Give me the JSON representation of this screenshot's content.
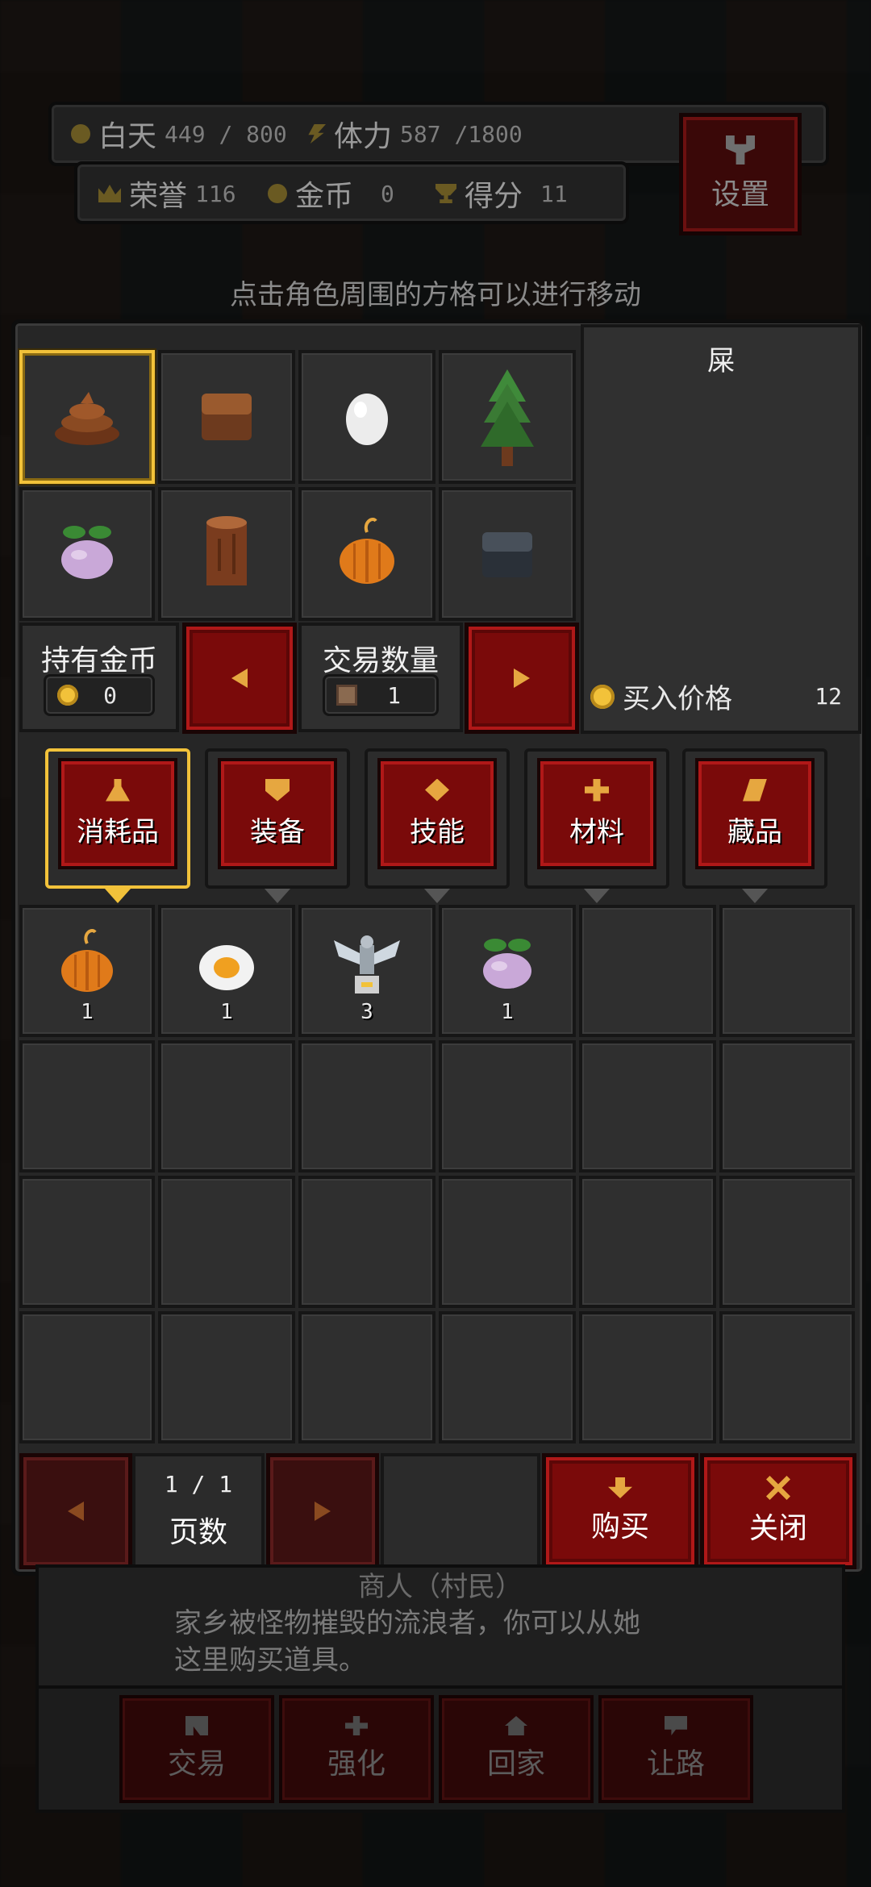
{
  "hud": {
    "day_label": "白天",
    "day_value": "449 / 800",
    "stamina_label": "体力",
    "stamina_value": "587 /1800",
    "honor_label": "荣誉",
    "honor_value": "116",
    "gold_label": "金币",
    "gold_value": "0",
    "score_label": "得分",
    "score_value": "11",
    "settings_label": "设置"
  },
  "hint": "点击角色周围的方格可以进行移动",
  "shop_items": [
    {
      "icon": "poop-icon",
      "selected": true
    },
    {
      "icon": "brick-block-icon"
    },
    {
      "icon": "egg-icon"
    },
    {
      "icon": "pine-tree-icon"
    },
    {
      "icon": "turnip-icon"
    },
    {
      "icon": "log-icon"
    },
    {
      "icon": "pumpkin-icon"
    },
    {
      "icon": "stone-block-icon"
    }
  ],
  "detail": {
    "name": "屎",
    "price_label": "买入价格",
    "price_value": "12"
  },
  "gold_box": {
    "label": "持有金币",
    "value": "0"
  },
  "qty_box": {
    "label": "交易数量",
    "value": "1"
  },
  "tabs": [
    {
      "label": "消耗品",
      "icon": "flask-icon",
      "selected": true
    },
    {
      "label": "装备",
      "icon": "shield-icon"
    },
    {
      "label": "技能",
      "icon": "diamond-icon"
    },
    {
      "label": "材料",
      "icon": "cross-icon"
    },
    {
      "label": "藏品",
      "icon": "scroll-icon"
    }
  ],
  "inventory": [
    {
      "icon": "pumpkin-icon",
      "count": "1"
    },
    {
      "icon": "fried-egg-icon",
      "count": "1"
    },
    {
      "icon": "winged-statue-icon",
      "count": "3"
    },
    {
      "icon": "turnip-icon",
      "count": "1"
    }
  ],
  "pager": {
    "page": "1 / 1",
    "label": "页数"
  },
  "buttons": {
    "buy": "购买",
    "close": "关闭"
  },
  "npc": {
    "name": "商人（村民）",
    "desc_line1": "家乡被怪物摧毁的流浪者，你可以从她",
    "desc_line2": "这里购买道具。"
  },
  "actions": [
    {
      "label": "交易",
      "icon": "trade-icon"
    },
    {
      "label": "强化",
      "icon": "plus-icon"
    },
    {
      "label": "回家",
      "icon": "home-icon"
    },
    {
      "label": "让路",
      "icon": "speech-icon"
    }
  ],
  "colors": {
    "accent": "#f2c23a",
    "button_red": "#7a0a0a",
    "panel": "#262626"
  }
}
